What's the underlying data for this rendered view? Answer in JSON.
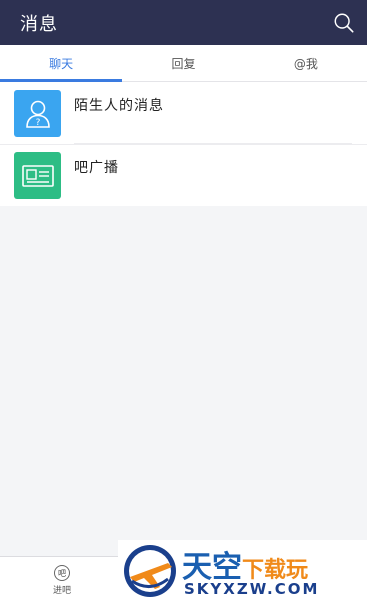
{
  "header": {
    "title": "消息",
    "search_icon": "search-icon"
  },
  "tabs": [
    {
      "label": "聊天",
      "active": true
    },
    {
      "label": "回复",
      "active": false
    },
    {
      "label": "@我",
      "active": false
    }
  ],
  "list": [
    {
      "label": "陌生人的消息",
      "icon": "stranger-icon",
      "color": "#3aa5f0"
    },
    {
      "label": "吧广播",
      "icon": "broadcast-icon",
      "color": "#2dbd85"
    }
  ],
  "bottom_nav": {
    "item_label": "进吧",
    "item_icon_text": "吧"
  },
  "watermark": {
    "title_main": "天空",
    "title_accent": "下载玩",
    "url": "SKYXZW.COM"
  },
  "colors": {
    "header_bg": "#2d3152",
    "accent": "#3a7be0",
    "blue_icon": "#3aa5f0",
    "green_icon": "#2dbd85"
  }
}
